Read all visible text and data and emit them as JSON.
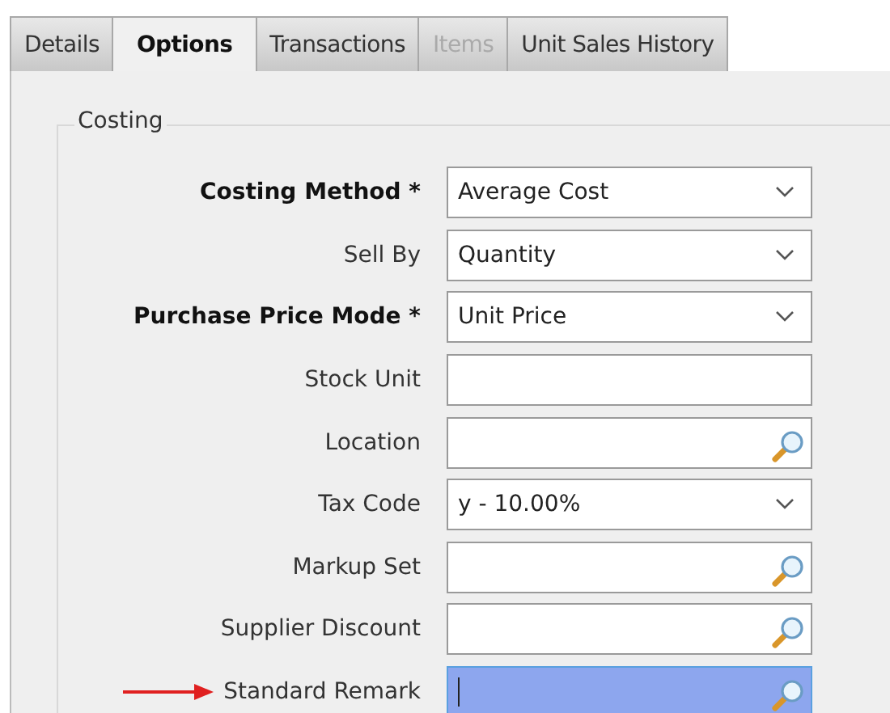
{
  "tabs": [
    {
      "label": "Details",
      "selected": false,
      "disabled": false
    },
    {
      "label": "Options",
      "selected": true,
      "disabled": false
    },
    {
      "label": "Transactions",
      "selected": false,
      "disabled": false
    },
    {
      "label": "Items",
      "selected": false,
      "disabled": true
    },
    {
      "label": "Unit Sales History",
      "selected": false,
      "disabled": false
    }
  ],
  "group": {
    "title": "Costing"
  },
  "fields": [
    {
      "label": "Costing Method *",
      "required": true,
      "kind": "select",
      "value": "Average Cost",
      "focused": false
    },
    {
      "label": "Sell By",
      "required": false,
      "kind": "select",
      "value": "Quantity",
      "focused": false
    },
    {
      "label": "Purchase Price Mode *",
      "required": true,
      "kind": "select",
      "value": "Unit Price",
      "focused": false
    },
    {
      "label": "Stock Unit",
      "required": false,
      "kind": "text",
      "focused": false
    },
    {
      "label": "Location",
      "required": false,
      "kind": "lookup",
      "focused": false
    },
    {
      "label": "Tax Code",
      "required": false,
      "kind": "select",
      "value": "y - 10.00%",
      "focused": false
    },
    {
      "label": "Markup Set",
      "required": false,
      "kind": "lookup",
      "focused": false
    },
    {
      "label": "Supplier Discount",
      "required": false,
      "kind": "lookup",
      "focused": false
    },
    {
      "label": "Standard Remark",
      "required": false,
      "kind": "lookup",
      "focused": true,
      "pointer": true
    }
  ]
}
